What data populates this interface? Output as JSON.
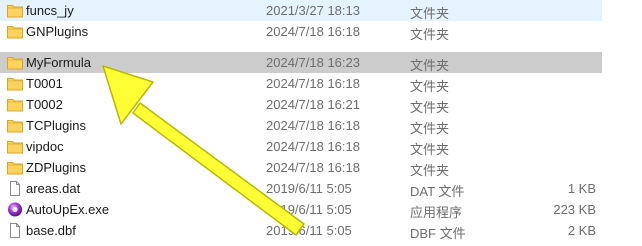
{
  "files": [
    {
      "name": "funcs_jy",
      "date": "2021/3/27 18:13",
      "type": "文件夹",
      "size": "",
      "icon": "folder-icon",
      "state": "hover"
    },
    {
      "name": "GNPlugins",
      "date": "2024/7/18 16:18",
      "type": "文件夹",
      "size": "",
      "icon": "folder-icon",
      "state": ""
    },
    {
      "name": "MyFormula",
      "date": "2024/7/18 16:23",
      "type": "文件夹",
      "size": "",
      "icon": "folder-icon",
      "state": "selected"
    },
    {
      "name": "T0001",
      "date": "2024/7/18 16:18",
      "type": "文件夹",
      "size": "",
      "icon": "folder-icon",
      "state": ""
    },
    {
      "name": "T0002",
      "date": "2024/7/18 16:21",
      "type": "文件夹",
      "size": "",
      "icon": "folder-icon",
      "state": ""
    },
    {
      "name": "TCPlugins",
      "date": "2024/7/18 16:18",
      "type": "文件夹",
      "size": "",
      "icon": "folder-icon",
      "state": ""
    },
    {
      "name": "vipdoc",
      "date": "2024/7/18 16:18",
      "type": "文件夹",
      "size": "",
      "icon": "folder-icon",
      "state": ""
    },
    {
      "name": "ZDPlugins",
      "date": "2024/7/18 16:18",
      "type": "文件夹",
      "size": "",
      "icon": "folder-icon",
      "state": ""
    },
    {
      "name": "areas.dat",
      "date": "2019/6/11 5:05",
      "type": "DAT 文件",
      "size": "1 KB",
      "icon": "file-icon",
      "state": ""
    },
    {
      "name": "AutoUpEx.exe",
      "date": "2019/6/11 5:05",
      "type": "应用程序",
      "size": "223 KB",
      "icon": "app-icon",
      "state": ""
    },
    {
      "name": "base.dbf",
      "date": "2019/6/11 5:05",
      "type": "DBF 文件",
      "size": "2 KB",
      "icon": "file-icon",
      "state": ""
    }
  ],
  "colors": {
    "selected_row": "#cccccc",
    "hover_row": "#e5f3ff",
    "folder": "#ffd25c",
    "annotation_arrow": "#ffff33"
  }
}
